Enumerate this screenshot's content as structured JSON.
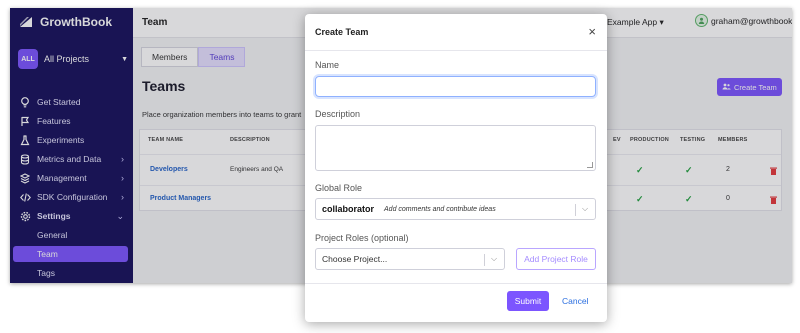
{
  "app": {
    "brand": "GrowthBook"
  },
  "sidebar": {
    "project_badge": "ALL",
    "project_name": "All Projects",
    "items": [
      {
        "label": "Get Started",
        "icon": "lightbulb-icon"
      },
      {
        "label": "Features",
        "icon": "flag-icon"
      },
      {
        "label": "Experiments",
        "icon": "flask-icon"
      },
      {
        "label": "Metrics and Data",
        "icon": "database-icon"
      },
      {
        "label": "Management",
        "icon": "stack-icon"
      },
      {
        "label": "SDK Configuration",
        "icon": "code-icon"
      },
      {
        "label": "Settings",
        "icon": "gear-icon"
      }
    ],
    "subitems": [
      "General",
      "Team",
      "Tags"
    ]
  },
  "topbar": {
    "title": "Team",
    "org": "Example App",
    "user": "graham@growthbook.io"
  },
  "tabs": [
    "Members",
    "Teams"
  ],
  "page": {
    "heading": "Teams",
    "description": "Place organization members into teams to grant",
    "create_button": "Create Team"
  },
  "table": {
    "headers": [
      "TEAM NAME",
      "DESCRIPTION",
      "EV",
      "PRODUCTION",
      "TESTING",
      "MEMBERS"
    ],
    "rows": [
      {
        "name": "Developers",
        "description": "Engineers and QA",
        "members": "2"
      },
      {
        "name": "Product Managers",
        "description": "",
        "members": "0"
      }
    ]
  },
  "modal": {
    "title": "Create Team",
    "name_label": "Name",
    "description_label": "Description",
    "global_role_label": "Global Role",
    "global_role_value": "collaborator",
    "global_role_hint": "Add comments and contribute ideas",
    "project_roles_label": "Project Roles (optional)",
    "project_placeholder": "Choose Project...",
    "add_project_role": "Add Project Role",
    "submit": "Submit",
    "cancel": "Cancel"
  },
  "colors": {
    "sidebar_bg": "#16115c",
    "accent": "#7c55ff",
    "link": "#2563c9",
    "success": "#22a13f",
    "danger": "#e5383b"
  }
}
